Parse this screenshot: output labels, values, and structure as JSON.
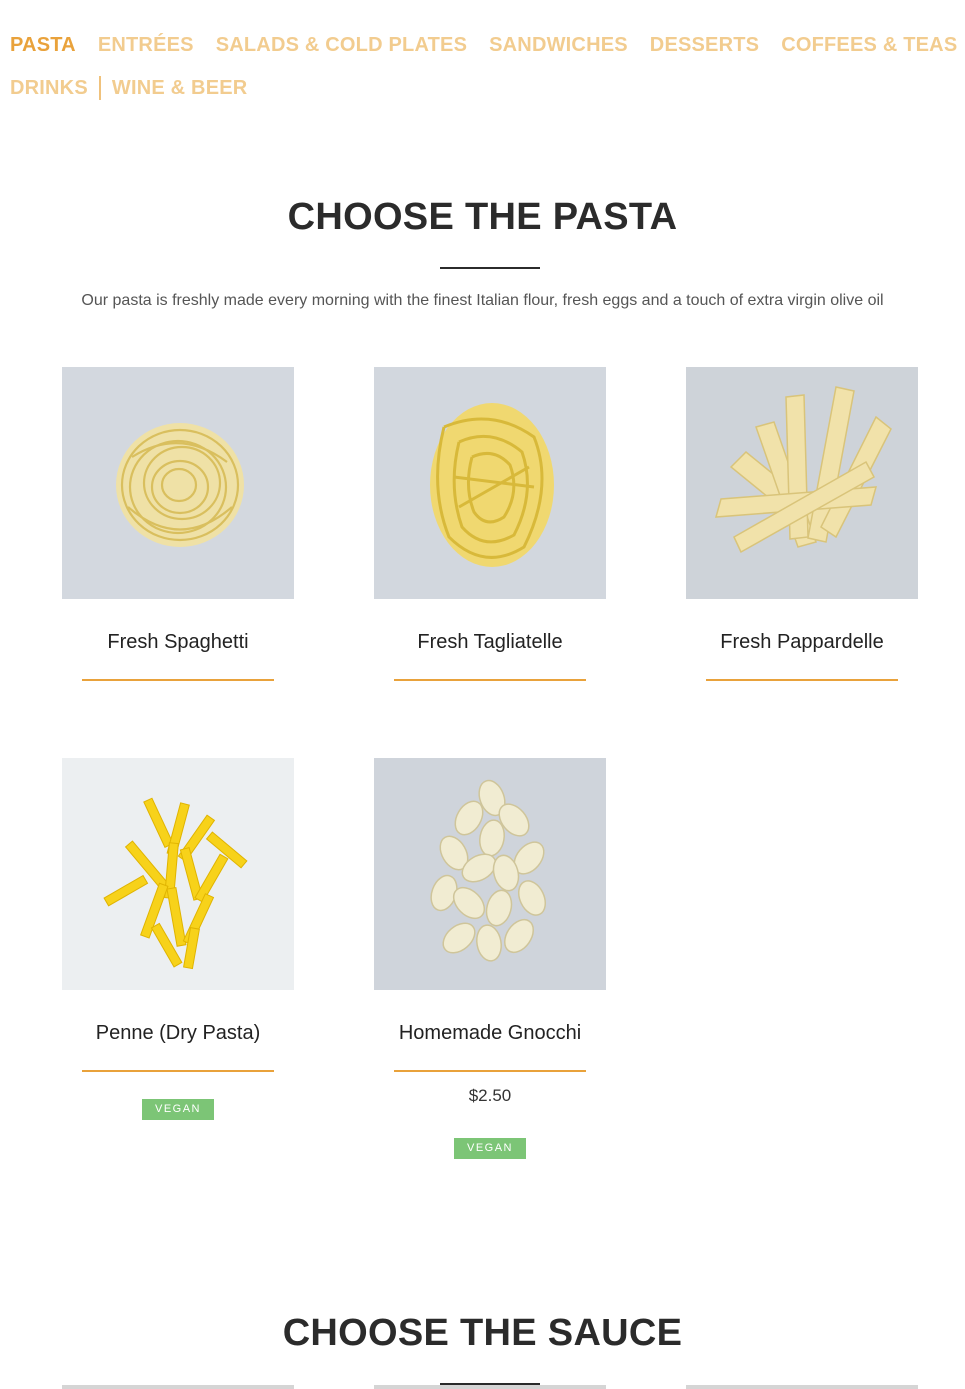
{
  "nav": {
    "row1": [
      "PASTA",
      "ENTRÉES",
      "SALADS & COLD PLATES",
      "SANDWICHES",
      "DESSERTS",
      "COFFEES & TEAS"
    ],
    "row2": [
      "DRINKS",
      "WINE & BEER"
    ],
    "active": "PASTA"
  },
  "pasta_section": {
    "title": "CHOOSE THE PASTA",
    "subtitle": "Our pasta is freshly made every morning with the finest Italian flour, fresh eggs and a touch of extra virgin olive oil",
    "items": [
      {
        "name": "Fresh Spaghetti",
        "price": "",
        "badge": "",
        "photo": "spaghetti-photo"
      },
      {
        "name": "Fresh Tagliatelle",
        "price": "",
        "badge": "",
        "photo": "tagliatelle-photo"
      },
      {
        "name": "Fresh Pappardelle",
        "price": "",
        "badge": "",
        "photo": "pappardelle-photo"
      },
      {
        "name": "Penne (Dry Pasta)",
        "price": "",
        "badge": "VEGAN",
        "photo": "penne-photo"
      },
      {
        "name": "Homemade Gnocchi",
        "price": "$2.50",
        "badge": "VEGAN",
        "photo": "gnocchi-photo"
      }
    ]
  },
  "sauce_section": {
    "title": "CHOOSE THE SAUCE"
  },
  "colors": {
    "nav_active": "#e9a23b",
    "nav_inactive": "#f2cc8f",
    "accent_rule": "#e9a23b",
    "vegan_badge": "#7cc576",
    "heading": "#2b2b2b"
  }
}
